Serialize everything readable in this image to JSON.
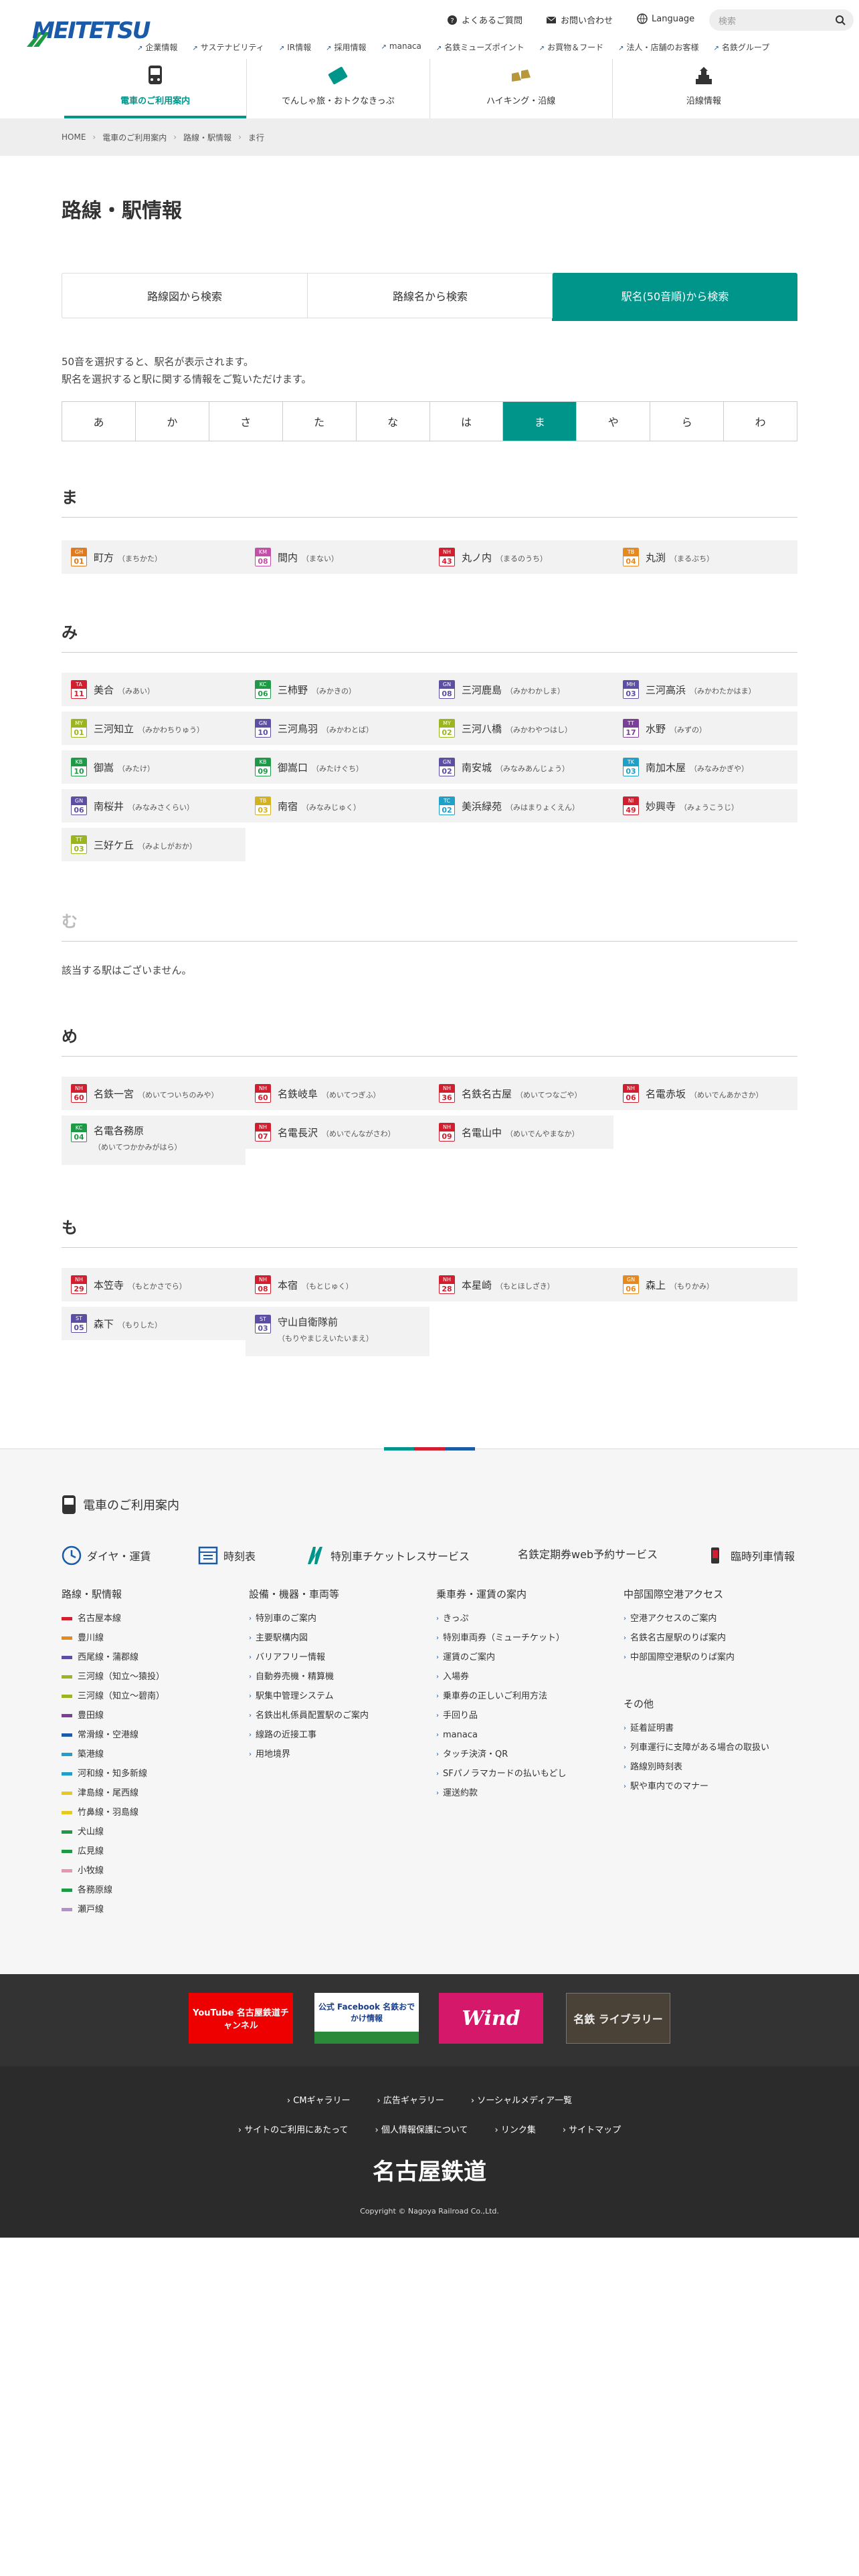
{
  "header": {
    "logo": "MEITETSU",
    "util": {
      "faq": "よくあるご質問",
      "contact": "お問い合わせ",
      "language": "Language",
      "search_placeholder": "検索"
    },
    "sublinks": [
      "企業情報",
      "サステナビリティ",
      "IR情報",
      "採用情報",
      "manaca",
      "名鉄ミューズポイント",
      "お買物＆フード",
      "法人・店舗のお客様",
      "名鉄グループ"
    ],
    "gnav": [
      "電車のご利用案内",
      "でんしゃ旅・おトクなきっぷ",
      "ハイキング・沿線",
      "沿線情報"
    ]
  },
  "breadcrumb": [
    "HOME",
    "電車のご利用案内",
    "路線・駅情報",
    "ま行"
  ],
  "page_title": "路線・駅情報",
  "tabs": [
    "路線図から検索",
    "路線名から検索",
    "駅名(50音順)から検索"
  ],
  "help": [
    "50音を選択すると、駅名が表示されます。",
    "駅名を選択すると駅に関する情報をご覧いただけます。"
  ],
  "kana": [
    "あ",
    "か",
    "さ",
    "た",
    "な",
    "は",
    "ま",
    "や",
    "ら",
    "わ"
  ],
  "sections": {
    "ma": {
      "heading": "ま",
      "stations": [
        {
          "code": "GH",
          "num": "01",
          "name": "町方",
          "ruby": "（まちかた）",
          "color": "#e07a1f"
        },
        {
          "code": "KM",
          "num": "08",
          "name": "間内",
          "ruby": "（まない）",
          "color": "#c44fa6"
        },
        {
          "code": "NH",
          "num": "43",
          "name": "丸ノ内",
          "ruby": "（まるのうち）",
          "color": "#d21f2f"
        },
        {
          "code": "TB",
          "num": "04",
          "name": "丸渕",
          "ruby": "（まるぶち）",
          "color": "#e68a1f"
        }
      ]
    },
    "mi": {
      "heading": "み",
      "stations": [
        {
          "code": "TA",
          "num": "11",
          "name": "美合",
          "ruby": "（みあい）",
          "color": "#d21f2f"
        },
        {
          "code": "KC",
          "num": "06",
          "name": "三柿野",
          "ruby": "（みかきの）",
          "color": "#1e9a47"
        },
        {
          "code": "GN",
          "num": "08",
          "name": "三河鹿島",
          "ruby": "（みかわかしま）",
          "color": "#5b4ea3"
        },
        {
          "code": "MH",
          "num": "03",
          "name": "三河高浜",
          "ruby": "（みかわたかはま）",
          "color": "#5b4ea3"
        },
        {
          "code": "MY",
          "num": "01",
          "name": "三河知立",
          "ruby": "（みかわちりゅう）",
          "color": "#9ab520"
        },
        {
          "code": "GN",
          "num": "10",
          "name": "三河鳥羽",
          "ruby": "（みかわとば）",
          "color": "#5b4ea3"
        },
        {
          "code": "MY",
          "num": "02",
          "name": "三河八橋",
          "ruby": "（みかわやつはし）",
          "color": "#9ab520"
        },
        {
          "code": "TT",
          "num": "17",
          "name": "水野",
          "ruby": "（みずの）",
          "color": "#7a3f98"
        },
        {
          "code": "KB",
          "num": "10",
          "name": "御嵩",
          "ruby": "（みたけ）",
          "color": "#1e9a47"
        },
        {
          "code": "KB",
          "num": "09",
          "name": "御嵩口",
          "ruby": "（みたけぐち）",
          "color": "#1e9a47"
        },
        {
          "code": "GN",
          "num": "02",
          "name": "南安城",
          "ruby": "（みなみあんじょう）",
          "color": "#5b4ea3"
        },
        {
          "code": "TK",
          "num": "03",
          "name": "南加木屋",
          "ruby": "（みなみかぎや）",
          "color": "#1ea0c8"
        },
        {
          "code": "GN",
          "num": "06",
          "name": "南桜井",
          "ruby": "（みなみさくらい）",
          "color": "#5b4ea3"
        },
        {
          "code": "TB",
          "num": "03",
          "name": "南宿",
          "ruby": "（みなみじゅく）",
          "color": "#d2b21f"
        },
        {
          "code": "TC",
          "num": "02",
          "name": "美浜緑苑",
          "ruby": "（みはまりょくえん）",
          "color": "#1ea0c8"
        },
        {
          "code": "NI",
          "num": "49",
          "name": "妙興寺",
          "ruby": "（みょうこうじ）",
          "color": "#d21f2f"
        },
        {
          "code": "TT",
          "num": "03",
          "name": "三好ケ丘",
          "ruby": "（みよしがおか）",
          "color": "#9ab520"
        }
      ]
    },
    "mu": {
      "heading": "む",
      "none": "該当する駅はございません。"
    },
    "me": {
      "heading": "め",
      "stations": [
        {
          "code": "NH",
          "num": "60",
          "name": "名鉄一宮",
          "ruby": "（めいてついちのみや）",
          "color": "#d21f2f"
        },
        {
          "code": "NH",
          "num": "60",
          "name": "名鉄岐阜",
          "ruby": "（めいてつぎふ）",
          "color": "#d21f2f"
        },
        {
          "code": "NH",
          "num": "36",
          "name": "名鉄名古屋",
          "ruby": "（めいてつなごや）",
          "color": "#d21f2f"
        },
        {
          "code": "NH",
          "num": "06",
          "name": "名電赤坂",
          "ruby": "（めいでんあかさか）",
          "color": "#d21f2f"
        },
        {
          "code": "KC",
          "num": "04",
          "name": "名電各務原",
          "ruby": "（めいてつかかみがはら）",
          "color": "#1e9a47",
          "tall": true
        },
        {
          "code": "NH",
          "num": "07",
          "name": "名電長沢",
          "ruby": "（めいでんながさわ）",
          "color": "#d21f2f"
        },
        {
          "code": "NH",
          "num": "09",
          "name": "名電山中",
          "ruby": "（めいでんやまなか）",
          "color": "#d21f2f"
        }
      ]
    },
    "mo": {
      "heading": "も",
      "stations": [
        {
          "code": "NH",
          "num": "29",
          "name": "本笠寺",
          "ruby": "（もとかさでら）",
          "color": "#d21f2f"
        },
        {
          "code": "NH",
          "num": "08",
          "name": "本宿",
          "ruby": "（もとじゅく）",
          "color": "#d21f2f"
        },
        {
          "code": "NH",
          "num": "28",
          "name": "本星崎",
          "ruby": "（もとほしざき）",
          "color": "#d21f2f"
        },
        {
          "code": "GN",
          "num": "06",
          "name": "森上",
          "ruby": "（もりかみ）",
          "color": "#e68a1f"
        },
        {
          "code": "ST",
          "num": "05",
          "name": "森下",
          "ruby": "（もりした）",
          "color": "#5b4ea3"
        },
        {
          "code": "ST",
          "num": "03",
          "name": "守山自衛隊前",
          "ruby": "（もりやまじえいたいまえ）",
          "color": "#5b4ea3",
          "tall": true
        }
      ]
    }
  },
  "footer": {
    "heading": "電車のご利用案内",
    "quick": [
      "ダイヤ・運賃",
      "時刻表",
      "特別車チケットレスサービス",
      "名鉄定期券web予約サービス",
      "臨時列車情報"
    ],
    "col1": {
      "title": "路線・駅情報",
      "items": [
        {
          "label": "名古屋本線",
          "color": "#d21f2f"
        },
        {
          "label": "豊川線",
          "color": "#e68a1f"
        },
        {
          "label": "西尾線・蒲郡線",
          "color": "#5b4ea3"
        },
        {
          "label": "三河線（知立〜猿投）",
          "color": "#9ab520"
        },
        {
          "label": "三河線（知立〜碧南）",
          "color": "#9ab520"
        },
        {
          "label": "豊田線",
          "color": "#7a3f98"
        },
        {
          "label": "常滑線・空港線",
          "color": "#1a5aa8"
        },
        {
          "label": "築港線",
          "color": "#1ea0c8"
        },
        {
          "label": "河和線・知多新線",
          "color": "#1ea0c8"
        },
        {
          "label": "津島線・尾西線",
          "color": "#e6c81f"
        },
        {
          "label": "竹鼻線・羽島線",
          "color": "#e6c81f"
        },
        {
          "label": "犬山線",
          "color": "#1e9a47"
        },
        {
          "label": "広見線",
          "color": "#1e9a47"
        },
        {
          "label": "小牧線",
          "color": "#e895b5"
        },
        {
          "label": "各務原線",
          "color": "#1e9a47"
        },
        {
          "label": "瀬戸線",
          "color": "#b590c8"
        }
      ]
    },
    "col2": {
      "title": "設備・機器・車両等",
      "items": [
        "特別車のご案内",
        "主要駅構内図",
        "バリアフリー情報",
        "自動券売機・精算機",
        "駅集中管理システム",
        "名鉄出札係員配置駅のご案内",
        "線路の近接工事",
        "用地境界"
      ]
    },
    "col3": {
      "title": "乗車券・運賃の案内",
      "items": [
        "きっぷ",
        "特別車両券（ミューチケット）",
        "運賃のご案内",
        "入場券",
        "乗車券の正しいご利用方法",
        "手回り品",
        "manaca",
        "タッチ決済・QR",
        "SFパノラマカードの払いもどし",
        "運送約款"
      ]
    },
    "col4": {
      "title": "中部国際空港アクセス",
      "items": [
        "空港アクセスのご案内",
        "名鉄名古屋駅のりば案内",
        "中部国際空港駅のりば案内"
      ]
    },
    "col5": {
      "title": "その他",
      "items": [
        "延着証明書",
        "列車運行に支障がある場合の取扱い",
        "路線別時刻表",
        "駅や車内でのマナー"
      ]
    },
    "banners": [
      "YouTube 名古屋鉄道チャンネル",
      "公式 Facebook 名鉄おでかけ情報",
      "Wind",
      "名鉄 ライブラリー"
    ],
    "links1": [
      "CMギャラリー",
      "広告ギャラリー",
      "ソーシャルメディア一覧"
    ],
    "links2": [
      "サイトのご利用にあたって",
      "個人情報保護について",
      "リンク集",
      "サイトマップ"
    ],
    "corp": "名古屋鉄道",
    "copyright": "Copyright © Nagoya Railroad Co.,Ltd."
  }
}
